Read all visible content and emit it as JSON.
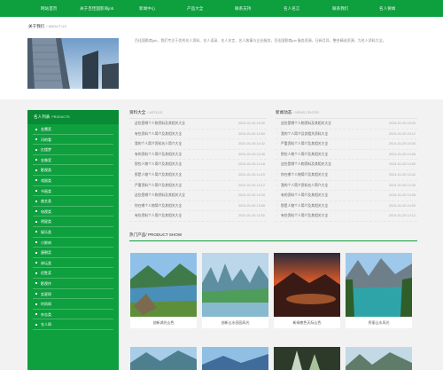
{
  "nav": [
    "网站首页",
    "关于百佳国影商job",
    "新闻中心",
    "产品大全",
    "联系支持",
    "名人名言",
    "联系我们",
    "名人要闻"
  ],
  "about": {
    "title": "关于我们",
    "title_en": "/ ABOUT US",
    "text": "百佳国影商job，我们专注于优秀名人资料、名人语录、名人名言、名人故事与企业服务，百佳国影商job 服务资源，日新月异，整合精选资源，为名人资料大全。"
  },
  "sidebar": {
    "title": "名人列表",
    "title_en": "PRODUCTS",
    "items": [
      "金鹰奖",
      "闪的看",
      "红楼梦",
      "金像奖",
      "影视类",
      "戏剧类",
      "书画类",
      "曲艺类",
      "电视类",
      "明星类",
      "娱乐类",
      "小鲜肉",
      "唐朝奖",
      "体坛类",
      "优胜奖",
      "影视作",
      "女星网",
      "时尚网",
      "杂志类",
      "名人网"
    ]
  },
  "articles": {
    "title": "资料大全",
    "title_en": "/ ARTICLE",
    "items": [
      {
        "text": "这些是哪个人物资料及其相关大全",
        "date": "2024-01-05 15:00"
      },
      {
        "text": "有些资料个人简介及其相关大全",
        "date": "2024-01-05 14:50"
      },
      {
        "text": "我的个人简介资料名人简介大全",
        "date": "2024-01-05 14:42"
      },
      {
        "text": "有的资料个人简介及其相关大全",
        "date": "2024-01-05 14:35"
      },
      {
        "text": "那些人物个人简介及其相关大全",
        "date": "2024-01-05 14:28"
      },
      {
        "text": "那是人物个人简介及其相关大全",
        "date": "2024-01-05 14:20"
      },
      {
        "text": "严重资料个人简介及其相关大全",
        "date": "2024-01-05 14:12"
      },
      {
        "text": "这些是哪个人物资料及其相关大全",
        "date": "2024-01-05 14:05"
      },
      {
        "text": "你在哪个人物简介及其相关大全",
        "date": "2024-01-05 13:58"
      },
      {
        "text": "有些资料个人简介及其相关大全",
        "date": "2024-01-05 13:50"
      }
    ]
  },
  "news": {
    "title": "新闻动态",
    "title_en": "/ NEWS CENTER",
    "items": [
      {
        "text": "这些是哪个人物资料及其相关大全",
        "date": "2024-01-05 15:20"
      },
      {
        "text": "我的个人简介及其相关资料大全",
        "date": "2024-01-05 15:12"
      },
      {
        "text": "严重资料个人简介及其相关大全",
        "date": "2024-01-05 15:05"
      },
      {
        "text": "那些人物个人简介及其相关大全",
        "date": "2024-01-05 14:58"
      },
      {
        "text": "这些是哪个人物资料及其相关大全",
        "date": "2024-01-05 14:50"
      },
      {
        "text": "你在哪个人物简介及其相关大全",
        "date": "2024-01-05 14:42"
      },
      {
        "text": "我的个人简介资料名人简介大全",
        "date": "2024-01-05 14:35"
      },
      {
        "text": "有的资料个人简介及其相关大全",
        "date": "2024-01-05 14:28"
      },
      {
        "text": "那是人物个人简介及其相关大全",
        "date": "2024-01-05 14:20"
      },
      {
        "text": "有些资料个人简介及其相关大全",
        "date": "2024-01-05 14:12"
      }
    ]
  },
  "hot": {
    "title": "热门产品",
    "title_en": "/ PRODUCT SHOW",
    "products": [
      {
        "caption": "创新湖光山色"
      },
      {
        "caption": "创新山水田园风光"
      },
      {
        "caption": "新绿夜色天际山色"
      },
      {
        "caption": "秀丽山水风光"
      }
    ]
  },
  "colors": {
    "brand_green": "#0e9f3f",
    "dark_green": "#098a35"
  }
}
